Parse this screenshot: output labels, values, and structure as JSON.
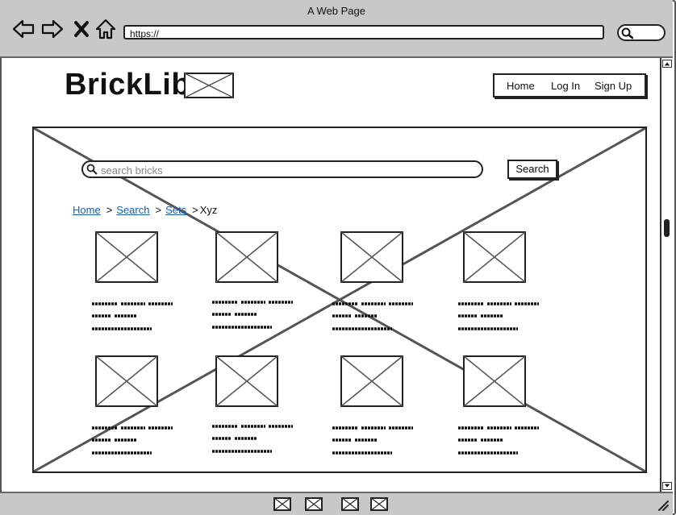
{
  "browser": {
    "window_title": "A Web Page",
    "url": "https://"
  },
  "site": {
    "logo_text": "BrickLib",
    "nav": [
      {
        "label": "Home"
      },
      {
        "label": "Log In"
      },
      {
        "label": "Sign Up"
      }
    ]
  },
  "search": {
    "placeholder": "search bricks",
    "button_label": "Search"
  },
  "breadcrumb": {
    "links": [
      "Home",
      "Search",
      "Sets"
    ],
    "current": "Xyz"
  },
  "grid": {
    "rows": 2,
    "columns": 4,
    "items": 8
  },
  "colors": {
    "chrome": "#c8c8c8",
    "link": "#1a5ea8",
    "ink": "#222222"
  }
}
